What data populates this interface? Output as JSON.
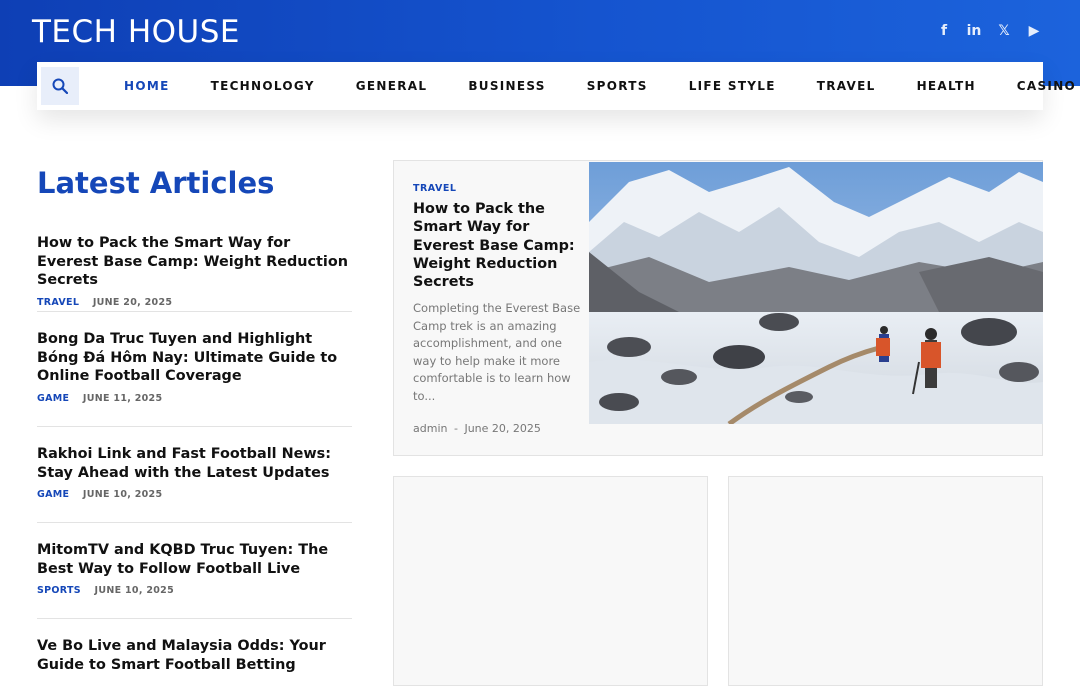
{
  "header": {
    "logo": "TECH HOUSE",
    "social": [
      {
        "icon": "facebook-icon",
        "glyph": "f"
      },
      {
        "icon": "linkedin-icon",
        "glyph": "in"
      },
      {
        "icon": "x-icon",
        "glyph": "𝕏"
      },
      {
        "icon": "youtube-icon",
        "glyph": "▶"
      }
    ]
  },
  "nav": {
    "items": [
      "HOME",
      "TECHNOLOGY",
      "GENERAL",
      "BUSINESS",
      "SPORTS",
      "LIFE STYLE",
      "TRAVEL",
      "HEALTH",
      "CASINO"
    ],
    "active": "HOME"
  },
  "latest": {
    "title": "Latest Articles",
    "articles": [
      {
        "title": "How to Pack the Smart Way for Everest Base Camp: Weight Reduction Secrets",
        "category": "TRAVEL",
        "date": "JUNE 20, 2025"
      },
      {
        "title": "Bong Da Truc Tuyen and Highlight Bóng Đá Hôm Nay: Ultimate Guide to Online Football Coverage",
        "category": "GAME",
        "date": "JUNE 11, 2025"
      },
      {
        "title": "Rakhoi Link and Fast Football News: Stay Ahead with the Latest Updates",
        "category": "GAME",
        "date": "JUNE 10, 2025"
      },
      {
        "title": "MitomTV and KQBD Truc Tuyen: The Best Way to Follow Football Live",
        "category": "SPORTS",
        "date": "JUNE 10, 2025"
      },
      {
        "title": "Ve Bo Live and Malaysia Odds: Your Guide to Smart Football Betting",
        "category": "",
        "date": ""
      }
    ]
  },
  "featured": {
    "category": "TRAVEL",
    "title": "How to Pack the Smart Way for Everest Base Camp: Weight Reduction Secrets",
    "excerpt": "Completing the Everest Base Camp trek is an amazing accomplishment, and one way to help make it more comfortable is to learn how to...",
    "author": "admin",
    "separator": "-",
    "date": "June 20, 2025"
  },
  "colors": {
    "brand": "#1547b8",
    "header_gradient_start": "#0e3fb5",
    "header_gradient_end": "#1c63dc"
  }
}
